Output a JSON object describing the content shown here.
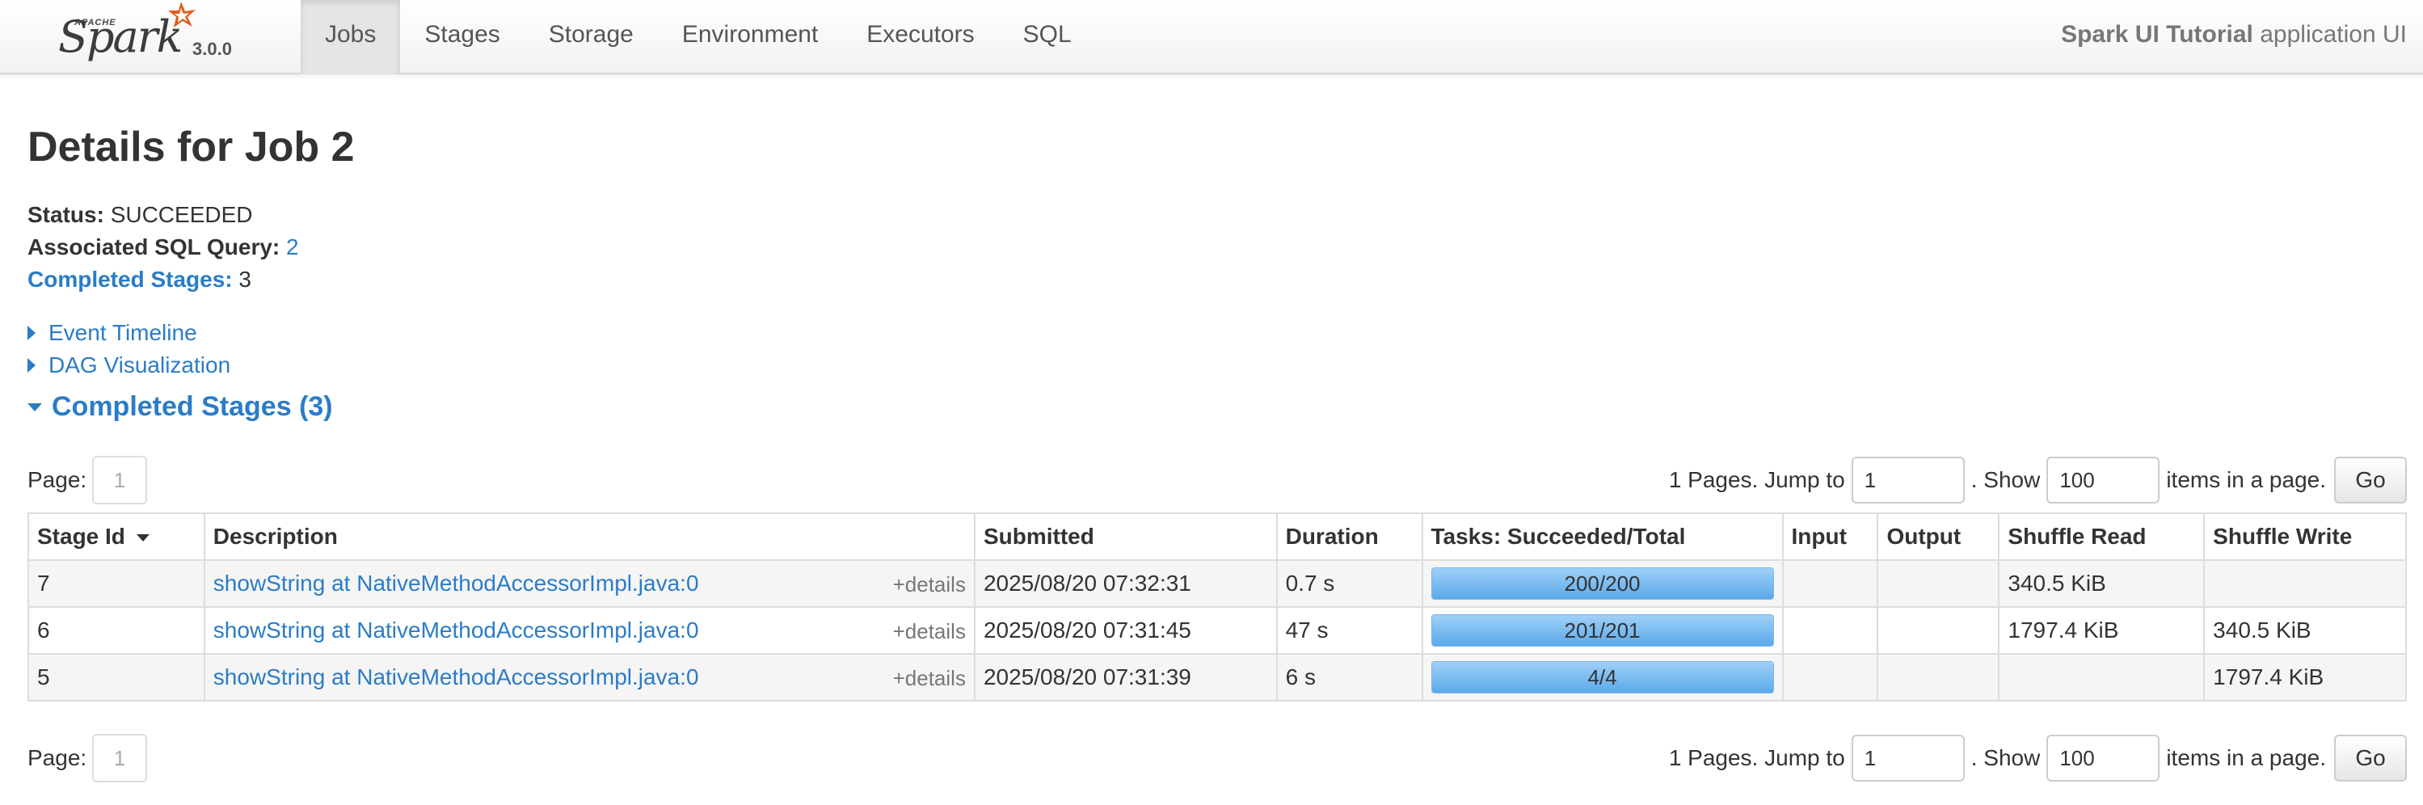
{
  "navbar": {
    "brand_apache": "APACHE",
    "brand_name": "Spark",
    "version": "3.0.0",
    "tabs": [
      {
        "label": "Jobs",
        "active": true
      },
      {
        "label": "Stages",
        "active": false
      },
      {
        "label": "Storage",
        "active": false
      },
      {
        "label": "Environment",
        "active": false
      },
      {
        "label": "Executors",
        "active": false
      },
      {
        "label": "SQL",
        "active": false
      }
    ],
    "app_name": "Spark UI Tutorial",
    "app_suffix": " application UI"
  },
  "page": {
    "title": "Details for Job 2",
    "status_label": "Status:",
    "status_value": "SUCCEEDED",
    "sql_label": "Associated SQL Query:",
    "sql_value": "2",
    "completed_label": "Completed Stages:",
    "completed_value": "3",
    "event_timeline": "Event Timeline",
    "dag_visualization": "DAG Visualization",
    "section_title": "Completed Stages (3)"
  },
  "pager": {
    "page_label": "Page:",
    "page_value": "1",
    "pages_jump_text": "1 Pages. Jump to",
    "jump_value": "1",
    "show_text": ". Show",
    "show_value": "100",
    "items_text": "items in a page.",
    "go_label": "Go"
  },
  "table": {
    "headers": [
      "Stage Id",
      "Description",
      "Submitted",
      "Duration",
      "Tasks: Succeeded/Total",
      "Input",
      "Output",
      "Shuffle Read",
      "Shuffle Write"
    ],
    "details_label": "+details",
    "rows": [
      {
        "stage_id": "7",
        "description": "showString at NativeMethodAccessorImpl.java:0",
        "submitted": "2025/08/20 07:32:31",
        "duration": "0.7 s",
        "tasks": "200/200",
        "tasks_fraction": 1.0,
        "input": "",
        "output": "",
        "shuffle_read": "340.5 KiB",
        "shuffle_write": ""
      },
      {
        "stage_id": "6",
        "description": "showString at NativeMethodAccessorImpl.java:0",
        "submitted": "2025/08/20 07:31:45",
        "duration": "47 s",
        "tasks": "201/201",
        "tasks_fraction": 1.0,
        "input": "",
        "output": "",
        "shuffle_read": "1797.4 KiB",
        "shuffle_write": "340.5 KiB"
      },
      {
        "stage_id": "5",
        "description": "showString at NativeMethodAccessorImpl.java:0",
        "submitted": "2025/08/20 07:31:39",
        "duration": "6 s",
        "tasks": "4/4",
        "tasks_fraction": 1.0,
        "input": "",
        "output": "",
        "shuffle_read": "",
        "shuffle_write": "1797.4 KiB"
      }
    ]
  },
  "colors": {
    "link": "#2b7cc6",
    "progress_fill": "#5aa9ea"
  }
}
